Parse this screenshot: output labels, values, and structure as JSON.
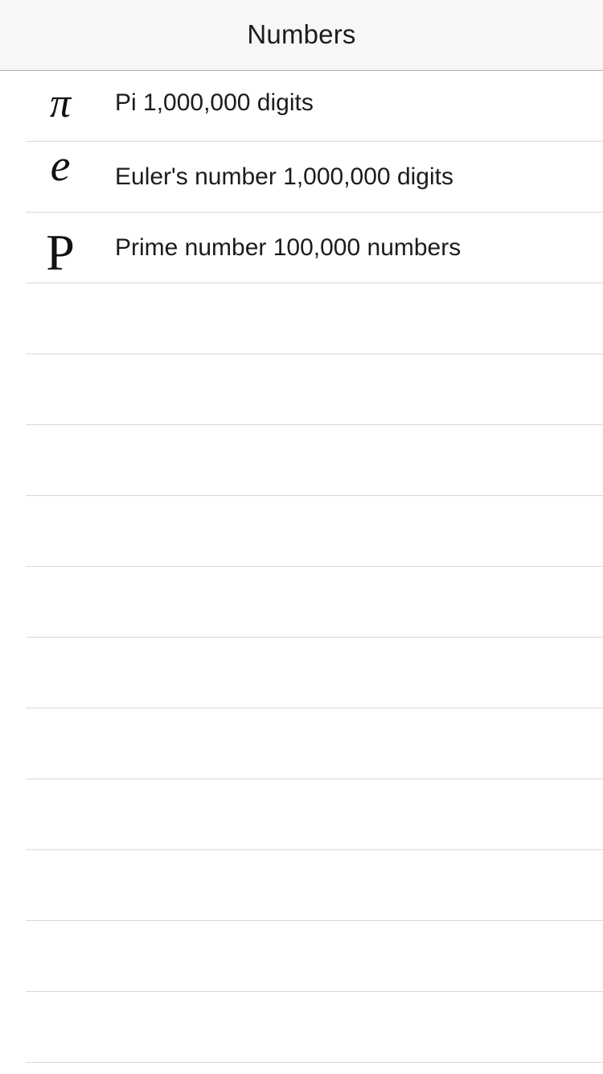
{
  "nav": {
    "title": "Numbers"
  },
  "list": {
    "items": [
      {
        "icon": "π",
        "icon_name": "pi-icon",
        "label": "Pi 1,000,000 digits"
      },
      {
        "icon": "e",
        "icon_name": "euler-e-icon",
        "label": "Euler's number 1,000,000 digits"
      },
      {
        "icon": "P",
        "icon_name": "prime-p-icon",
        "label": "Prime number 100,000 numbers"
      }
    ],
    "empty_rows": 11
  },
  "colors": {
    "nav_background": "#f7f7f7",
    "separator": "#d9d9d9",
    "text": "#1c1c1c",
    "background": "#ffffff"
  }
}
